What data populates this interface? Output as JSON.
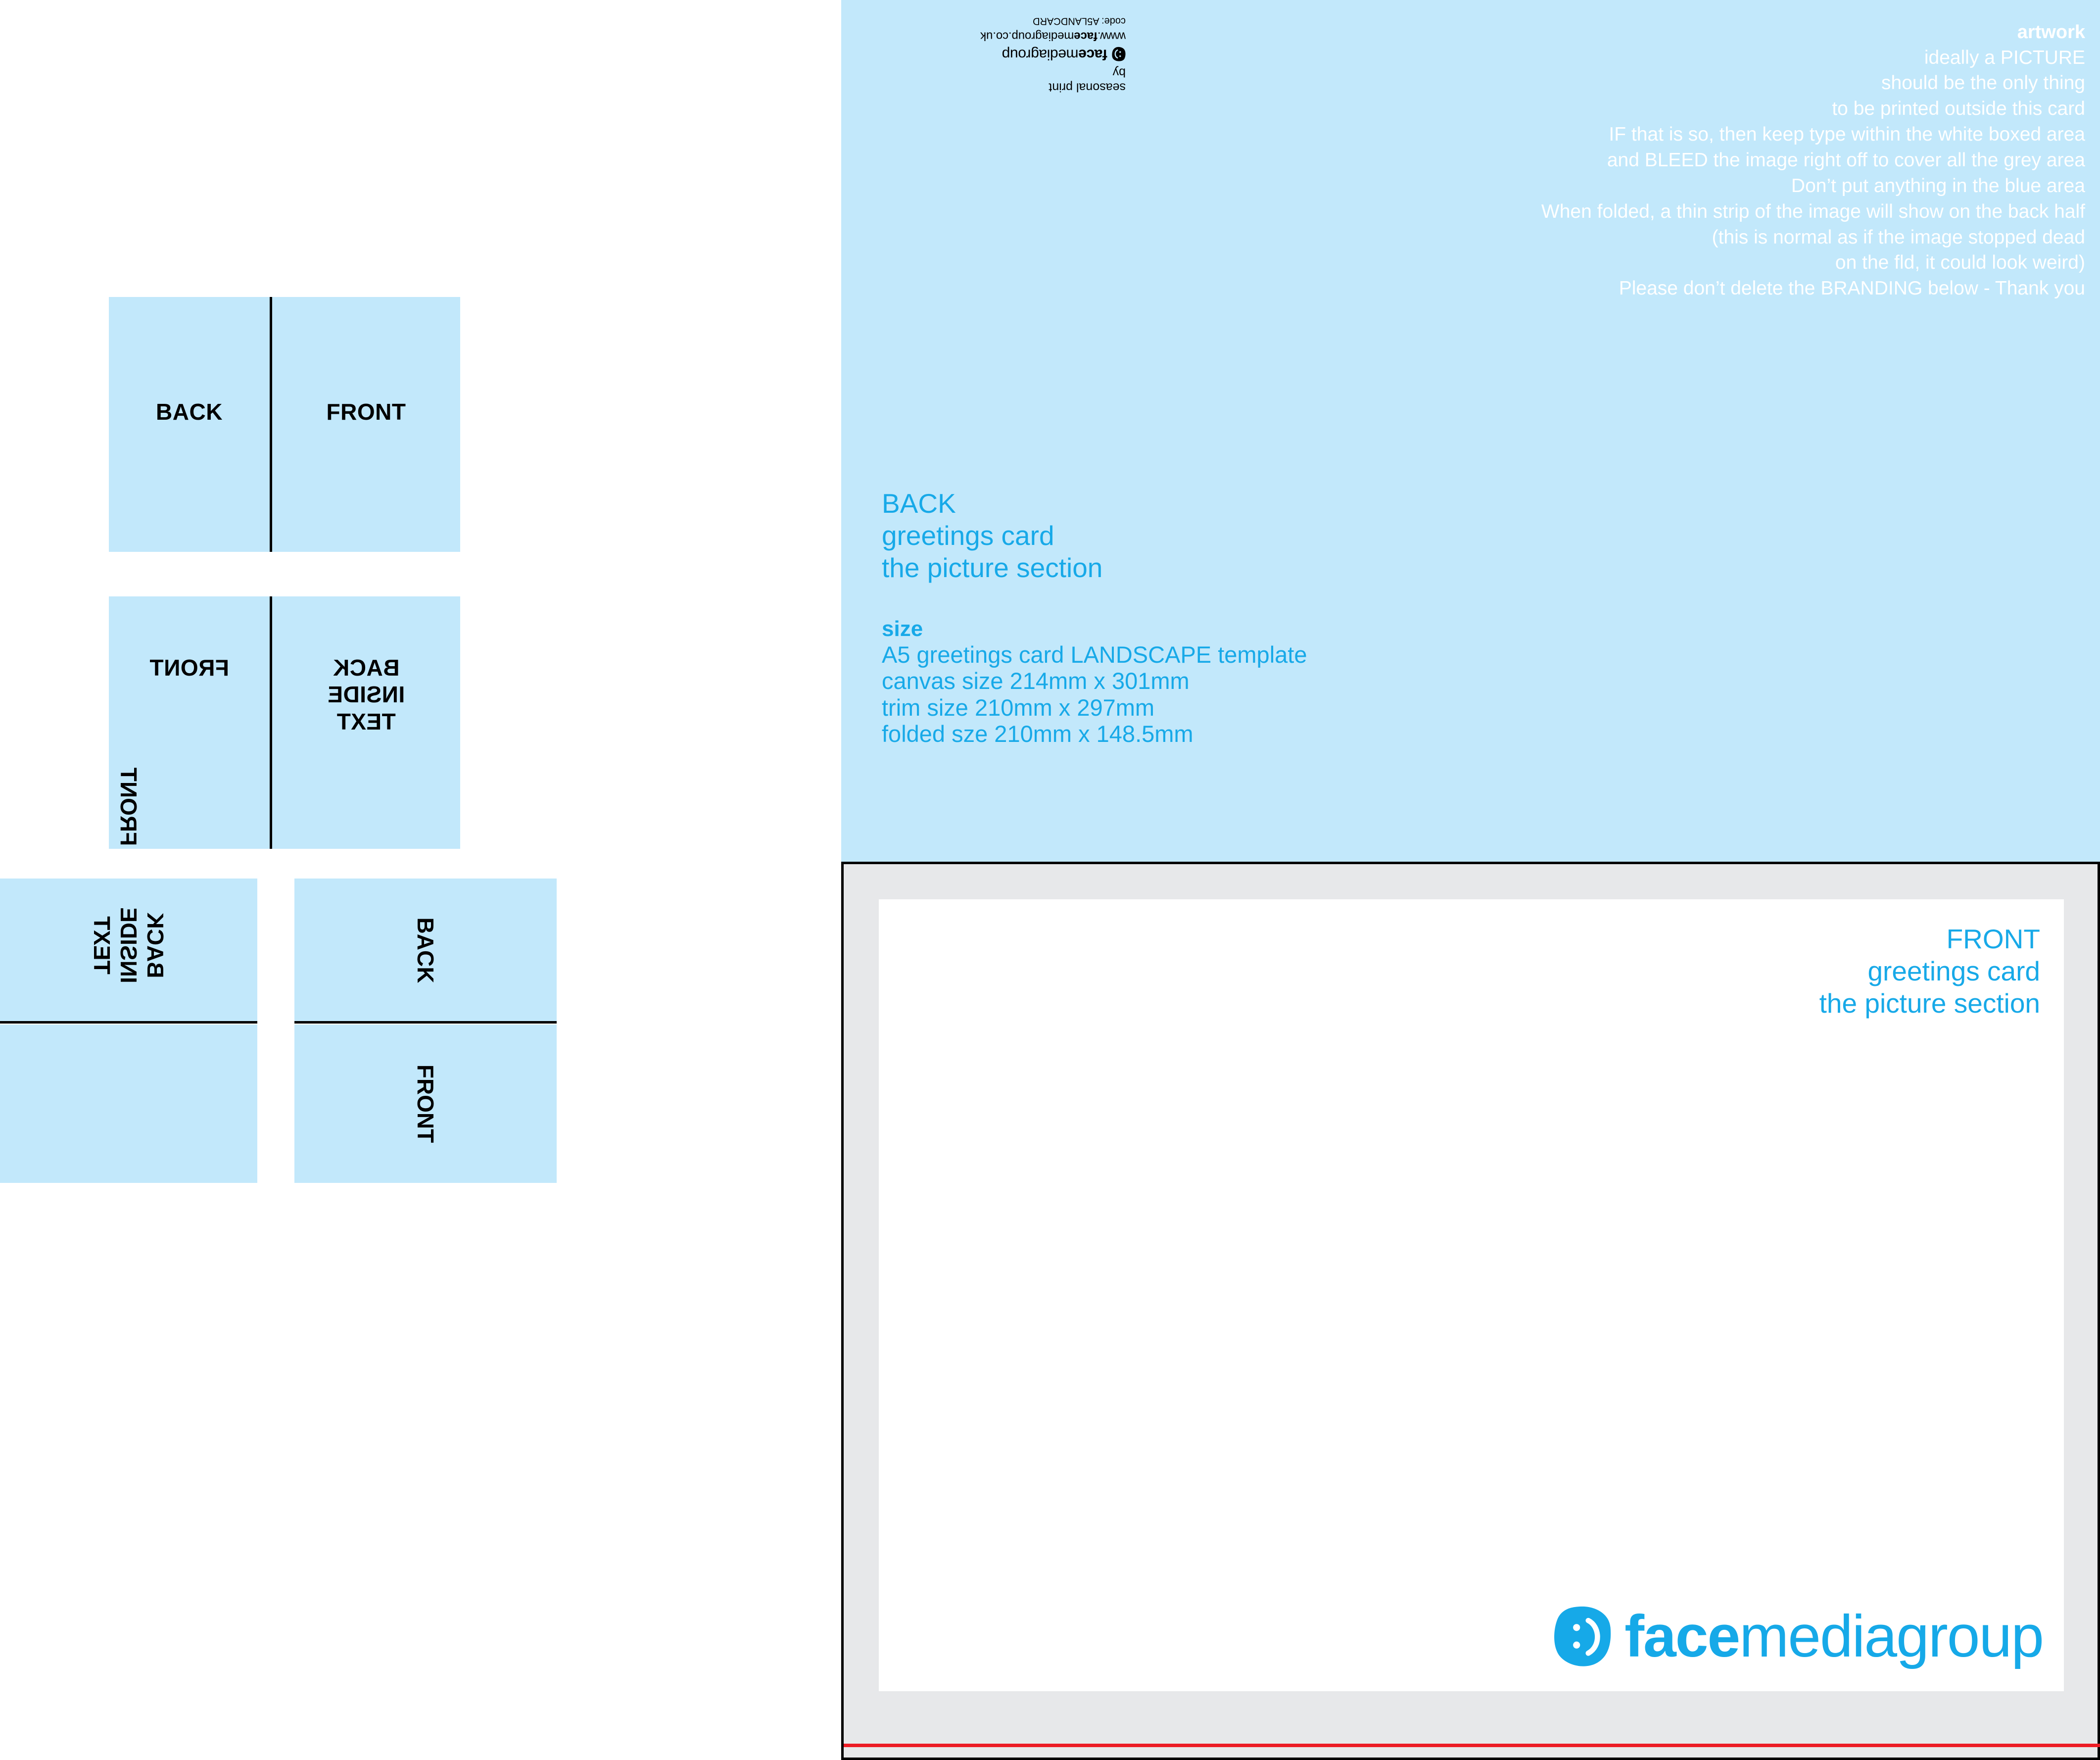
{
  "diagram": {
    "d1": {
      "left_label": "BACK",
      "right_label": "FRONT"
    },
    "d2": {
      "left_label": "FRONT",
      "right_label": "BACK\nINSIDE\nTEXT"
    },
    "d3": {
      "left_top_label": "FRONT",
      "left_bottom_label": "BACK\nINSIDE\nTEXT",
      "right_top_label": "BACK",
      "right_bottom_label": "FRONT"
    }
  },
  "branding": {
    "seasonal": "seasonal print",
    "by": "by",
    "name_bold": "face",
    "name_light": "mediagroup",
    "url_prefix": "www.",
    "url_bold": "face",
    "url_rest": "mediagroup.co.uk",
    "code": "code: A5LANDCARD"
  },
  "instructions": {
    "heading": "artwork",
    "lines": [
      "ideally a PICTURE",
      "should be the only thing",
      "to be printed outside this card",
      "IF that is so, then keep type within the white boxed area",
      "and BLEED the image right off to cover all the grey area",
      "Don’t put anything in the blue area",
      "When folded, a thin strip of the image will show on the back half",
      "(this is normal as if the image stopped dead",
      "on the fld, it could look weird)",
      "Please don’t delete the BRANDING below - Thank you"
    ]
  },
  "back_block": {
    "title": "BACK",
    "line2": "greetings card",
    "line3": "the picture section",
    "size_heading": "size",
    "size_lines": [
      "A5 greetings card LANDSCAPE template",
      "canvas size 214mm x 301mm",
      "trim size 210mm x 297mm",
      "folded sze 210mm x 148.5mm"
    ]
  },
  "front_block": {
    "title": "FRONT",
    "line2": "greetings card",
    "line3": "the picture section"
  },
  "logo": {
    "bold": "face",
    "light": "mediagroup"
  },
  "colors": {
    "blue_fill": "#c2e8fb",
    "brand_blue": "#16a9e8",
    "trim_red": "#ec1c24",
    "bleed_grey": "#e7e8ea",
    "white": "#ffffff",
    "black": "#000000"
  }
}
